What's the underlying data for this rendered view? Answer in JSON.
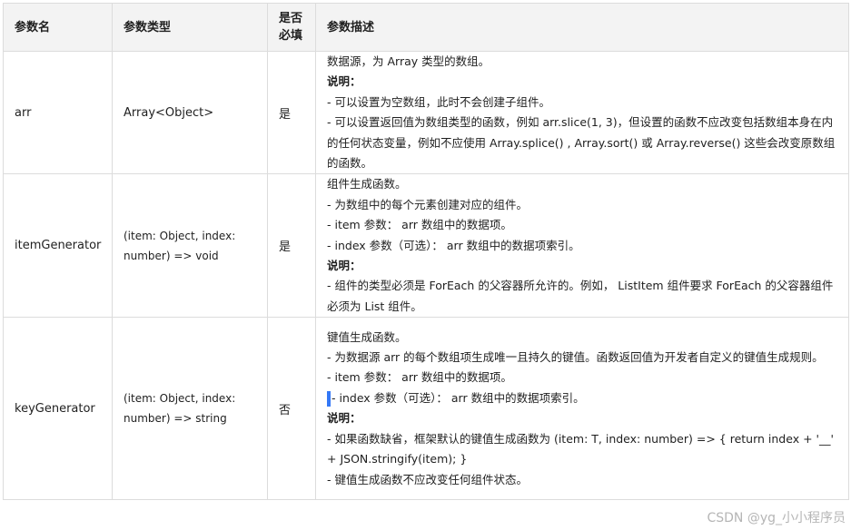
{
  "headers": [
    "参数名",
    "参数类型",
    "是否\n必填",
    "参数描述"
  ],
  "rows": [
    {
      "name": "arr",
      "type": "Array<Object>",
      "required": "是",
      "desc": [
        "数据源，为 Array 类型的数组。",
        "说明：",
        "- 可以设置为空数组，此时不会创建子组件。",
        "- 可以设置返回值为数组类型的函数，例如 arr.slice(1, 3)，但设置的函数不应改变包括数组本身在内的任何状态变量，例如不应使用 Array.splice() , Array.sort() 或 Array.reverse() 这些会改变原数组的函数。"
      ]
    },
    {
      "name": "itemGenerator",
      "type": "(item: Object, index: number) => void",
      "required": "是",
      "desc": [
        "组件生成函数。",
        "- 为数组中的每个元素创建对应的组件。",
        "- item 参数： arr 数组中的数据项。",
        "- index 参数（可选）： arr 数组中的数据项索引。",
        "说明：",
        "- 组件的类型必须是 ForEach 的父容器所允许的。例如， ListItem 组件要求 ForEach 的父容器组件必须为 List 组件。"
      ]
    },
    {
      "name": "keyGenerator",
      "type": "(item: Object, index: number) => string",
      "required": "否",
      "desc": [
        "键值生成函数。",
        "- 为数据源 arr 的每个数组项生成唯一且持久的键值。函数返回值为开发者自定义的键值生成规则。",
        "- item 参数： arr 数组中的数据项。",
        "- index 参数（可选）： arr 数组中的数据项索引。",
        "说明：",
        "- 如果函数缺省，框架默认的键值生成函数为 (item: T, index: number) => { return index + '__' + JSON.stringify(item); }",
        "- 键值生成函数不应改变任何组件状态。"
      ]
    }
  ],
  "watermark": "CSDN @yg_小小程序员"
}
